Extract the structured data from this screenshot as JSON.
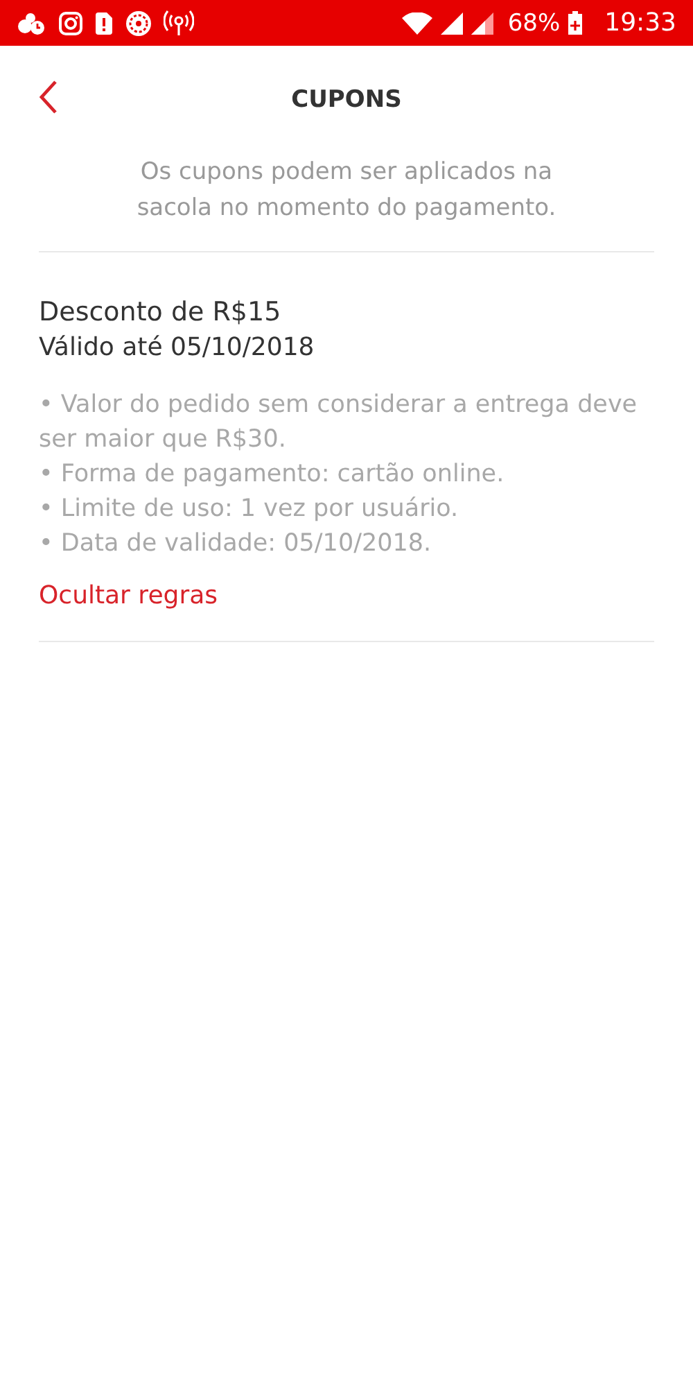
{
  "status_bar": {
    "battery": "68%",
    "time": "19:33"
  },
  "header": {
    "title": "CUPONS"
  },
  "intro": "Os cupons podem ser aplicados na sacola no momento do pagamento.",
  "coupons": [
    {
      "title": "Desconto de R$15",
      "validity": "Válido até 05/10/2018",
      "expanded": true,
      "rules": [
        "• Valor do pedido sem considerar a entrega deve ser maior que R$30.",
        "• Forma de pagamento: cartão online.",
        "• Limite de uso: 1 vez por usuário.",
        "• Data de validade: 05/10/2018."
      ],
      "toggle": "Ocultar regras"
    }
  ]
}
